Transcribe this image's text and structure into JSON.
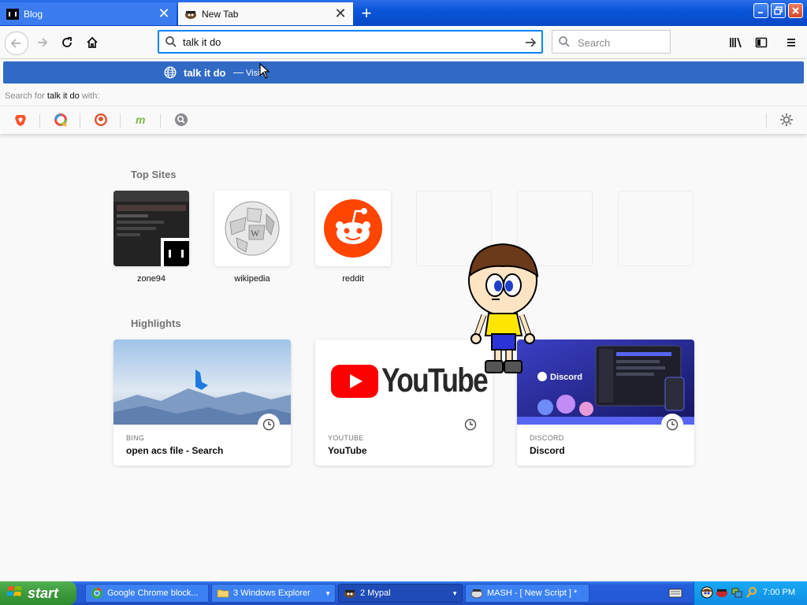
{
  "tabs": [
    {
      "title": "Blog",
      "active": false
    },
    {
      "title": "New Tab",
      "active": true
    }
  ],
  "toolbar": {
    "url_text": "talk it do",
    "search_placeholder": "Search"
  },
  "dropdown": {
    "suggestion_text": "talk it do",
    "separator": "—",
    "suggestion_action": "Visit",
    "search_for_prefix": "Search for",
    "search_for_query": "talk it do",
    "search_for_suffix": "with:",
    "engines": [
      "brave-icon",
      "qwant-icon",
      "duckduckgo-icon",
      "mojeek-icon",
      "searx-icon"
    ]
  },
  "newtab": {
    "top_sites_title": "Top Sites",
    "top_sites": [
      {
        "label": "zone94"
      },
      {
        "label": "wikipedia"
      },
      {
        "label": "reddit"
      },
      {
        "label": ""
      },
      {
        "label": ""
      },
      {
        "label": ""
      }
    ],
    "highlights_title": "Highlights",
    "highlights": [
      {
        "context": "BING",
        "title": "open acs file - Search",
        "thumb_text": ""
      },
      {
        "context": "YOUTUBE",
        "title": "YouTube",
        "thumb_text": "YouTube"
      },
      {
        "context": "DISCORD",
        "title": "Discord",
        "thumb_text": "Discord"
      }
    ]
  },
  "taskbar": {
    "start_label": "start",
    "tasks": [
      {
        "label": "Google Chrome block...",
        "active": false
      },
      {
        "label": "3 Windows Explorer",
        "active": false
      },
      {
        "label": "2 Mypal",
        "active": true
      },
      {
        "label": "MASH - [ New Script ] *",
        "active": false
      }
    ],
    "clock": "7:00 PM"
  },
  "colors": {
    "accent": "#0a84ff",
    "suggestion_bg": "#316ac5",
    "reddit": "#ff4500",
    "youtube_red": "#ff0000",
    "discord_bg": "#2b2d8f",
    "taskbar": "#245ddb",
    "start_green": "#3c9a3c"
  }
}
